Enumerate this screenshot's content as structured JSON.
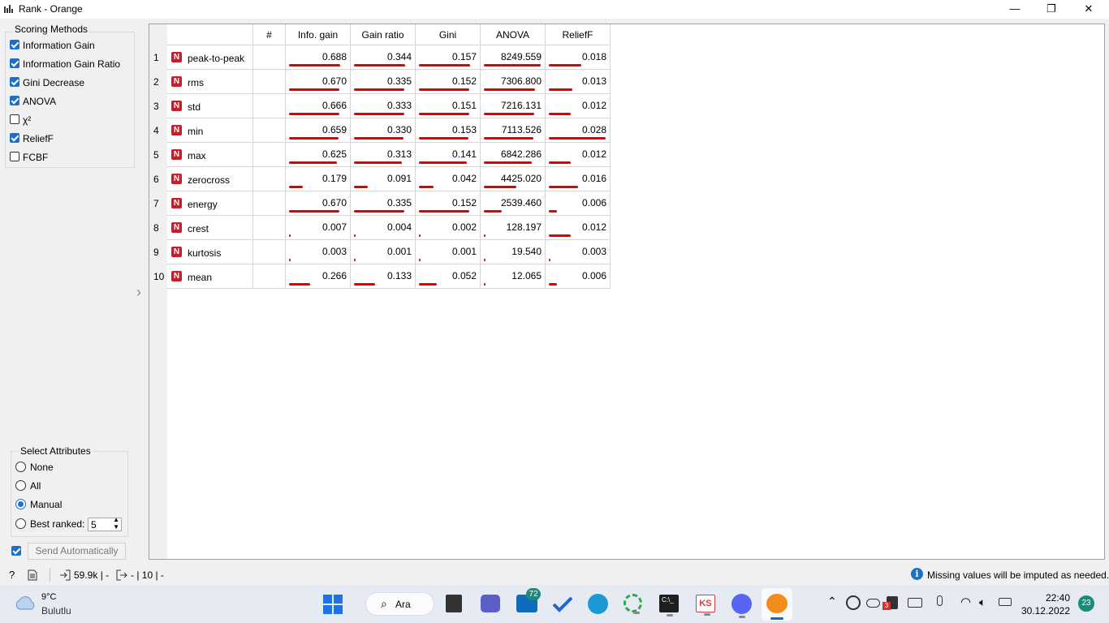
{
  "window": {
    "title": "Rank - Orange",
    "minimize": "—",
    "restore": "❐",
    "close": "✕"
  },
  "scoring": {
    "title": "Scoring Methods",
    "methods": [
      {
        "label": "Information Gain",
        "checked": true
      },
      {
        "label": "Information Gain Ratio",
        "checked": true
      },
      {
        "label": "Gini Decrease",
        "checked": true
      },
      {
        "label": "ANOVA",
        "checked": true
      },
      {
        "label": "χ²",
        "checked": false
      },
      {
        "label": "ReliefF",
        "checked": true
      },
      {
        "label": "FCBF",
        "checked": false
      }
    ]
  },
  "select_attributes": {
    "title": "Select Attributes",
    "options": [
      {
        "label": "None",
        "selected": false
      },
      {
        "label": "All",
        "selected": false
      },
      {
        "label": "Manual",
        "selected": true
      },
      {
        "label": "Best ranked:",
        "selected": false
      }
    ],
    "best_ranked_value": "5"
  },
  "send_automatically": {
    "label": "Send Automatically",
    "checked": true
  },
  "table": {
    "headers": [
      "#",
      "Info. gain",
      "Gain ratio",
      "Gini",
      "ANOVA",
      "ReliefF"
    ],
    "rows": [
      {
        "num": "1",
        "type": "N",
        "name": "peak-to-peak",
        "values": [
          "0.688",
          "0.344",
          "0.157",
          "8249.559",
          "0.018"
        ],
        "bars": [
          0.88,
          0.88,
          0.88,
          0.97,
          0.55
        ]
      },
      {
        "num": "2",
        "type": "N",
        "name": "rms",
        "values": [
          "0.670",
          "0.335",
          "0.152",
          "7306.800",
          "0.013"
        ],
        "bars": [
          0.86,
          0.86,
          0.86,
          0.88,
          0.4
        ]
      },
      {
        "num": "3",
        "type": "N",
        "name": "std",
        "values": [
          "0.666",
          "0.333",
          "0.151",
          "7216.131",
          "0.012"
        ],
        "bars": [
          0.86,
          0.86,
          0.86,
          0.86,
          0.37
        ]
      },
      {
        "num": "4",
        "type": "N",
        "name": "min",
        "values": [
          "0.659",
          "0.330",
          "0.153",
          "7113.526",
          "0.028"
        ],
        "bars": [
          0.85,
          0.85,
          0.85,
          0.85,
          0.97
        ]
      },
      {
        "num": "5",
        "type": "N",
        "name": "max",
        "values": [
          "0.625",
          "0.313",
          "0.141",
          "6842.286",
          "0.012"
        ],
        "bars": [
          0.82,
          0.82,
          0.82,
          0.82,
          0.37
        ]
      },
      {
        "num": "6",
        "type": "N",
        "name": "zerocross",
        "values": [
          "0.179",
          "0.091",
          "0.042",
          "4425.020",
          "0.016"
        ],
        "bars": [
          0.23,
          0.23,
          0.25,
          0.55,
          0.5
        ]
      },
      {
        "num": "7",
        "type": "N",
        "name": "energy",
        "values": [
          "0.670",
          "0.335",
          "0.152",
          "2539.460",
          "0.006"
        ],
        "bars": [
          0.86,
          0.86,
          0.86,
          0.3,
          0.14
        ]
      },
      {
        "num": "8",
        "type": "N",
        "name": "crest",
        "values": [
          "0.007",
          "0.004",
          "0.002",
          "128.197",
          "0.012"
        ],
        "bars": [
          0.02,
          0.02,
          0.02,
          0.02,
          0.37
        ]
      },
      {
        "num": "9",
        "type": "N",
        "name": "kurtosis",
        "values": [
          "0.003",
          "0.001",
          "0.001",
          "19.540",
          "0.003"
        ],
        "bars": [
          0.02,
          0.02,
          0.02,
          0.02,
          0.02
        ]
      },
      {
        "num": "10",
        "type": "N",
        "name": "mean",
        "values": [
          "0.266",
          "0.133",
          "0.052",
          "12.065",
          "0.006"
        ],
        "bars": [
          0.36,
          0.36,
          0.31,
          0.02,
          0.14
        ]
      }
    ]
  },
  "status": {
    "input_summary": "59.9k | -",
    "output_summary": "- | 10 | -",
    "message": "Missing values will be imputed as needed."
  },
  "taskbar": {
    "weather_temp": "9°C",
    "weather_desc": "Bulutlu",
    "search_label": "Ara",
    "mail_badge": "72",
    "time": "22:40",
    "date": "30.12.2022",
    "notif_count": "23",
    "app_badge": "3"
  },
  "colors": {
    "bar": "#e00000",
    "checkbox": "#1e6fc9",
    "numeric_badge": "#c3202d",
    "info_icon": "#1e6fc9"
  }
}
